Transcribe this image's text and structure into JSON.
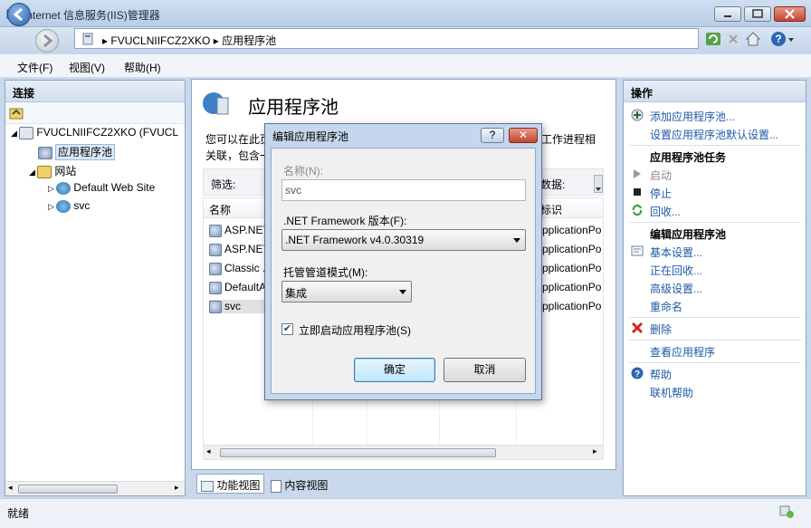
{
  "window": {
    "title": "Internet 信息服务(IIS)管理器"
  },
  "address": {
    "crumbs": [
      "FVUCLNIIFCZ2XKO",
      "应用程序池"
    ]
  },
  "menu": {
    "file": "文件(F)",
    "view": "视图(V)",
    "help": "帮助(H)"
  },
  "connections": {
    "header": "连接",
    "tree": {
      "server": "FVUCLNIIFCZ2XKO (FVUCL",
      "app_pools": "应用程序池",
      "sites": "网站",
      "site_default": "Default Web Site",
      "site_svc": "svc"
    }
  },
  "center": {
    "title": "应用程序池",
    "desc_line1": "您可以在此页",
    "desc_line1_tail": "工作进程相",
    "desc_line2": "关联，包含一",
    "filter_label": "筛选:",
    "data_label": "数据:",
    "col_name": "名称",
    "col_identity": "标识",
    "rows": [
      {
        "name": "ASP.NET",
        "identity": "pplicationPo"
      },
      {
        "name": "ASP.NET",
        "identity": "pplicationPo"
      },
      {
        "name": "Classic .",
        "identity": "pplicationPo"
      },
      {
        "name": "DefaultA",
        "identity": "pplicationPo"
      },
      {
        "name": "svc",
        "identity": "pplicationPo"
      }
    ],
    "tab_features": "功能视图",
    "tab_content": "内容视图"
  },
  "actions": {
    "header": "操作",
    "add_pool": "添加应用程序池...",
    "set_defaults": "设置应用程序池默认设置...",
    "tasks_header": "应用程序池任务",
    "start": "启动",
    "stop": "停止",
    "recycle": "回收...",
    "edit_header": "编辑应用程序池",
    "basic_settings": "基本设置...",
    "recycling": "正在回收...",
    "advanced": "高级设置...",
    "rename": "重命名",
    "delete": "删除",
    "view_apps": "查看应用程序",
    "help": "帮助",
    "online_help": "联机帮助"
  },
  "status": {
    "text": "就绪"
  },
  "dialog": {
    "title": "编辑应用程序池",
    "help_btn": "?",
    "close_btn": "✕",
    "name_label": "名称(N):",
    "name_value": "svc",
    "framework_label": ".NET Framework 版本(F):",
    "framework_value": ".NET Framework v4.0.30319",
    "pipeline_label": "托管管道模式(M):",
    "pipeline_value": "集成",
    "autostart_label": "立即启动应用程序池(S)",
    "autostart_checked": true,
    "ok": "确定",
    "cancel": "取消"
  }
}
